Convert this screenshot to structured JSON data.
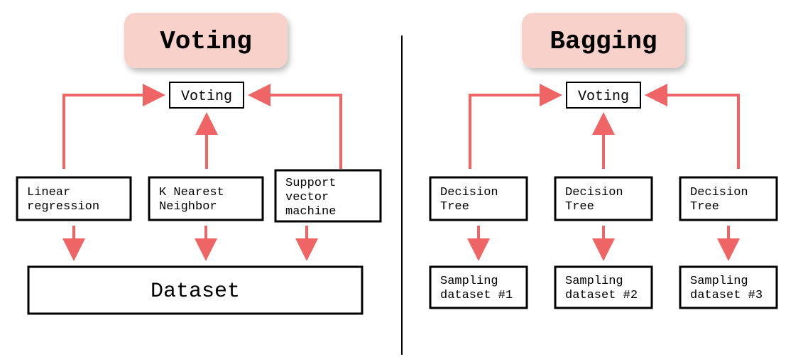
{
  "left": {
    "title": "Voting",
    "aggregator": "Voting",
    "models": [
      "Linear\nregression",
      "K Nearest\nNeighbor",
      "Support\nvector\nmachine"
    ],
    "dataset": "Dataset"
  },
  "right": {
    "title": "Bagging",
    "aggregator": "Voting",
    "models": [
      "Decision\nTree",
      "Decision\nTree",
      "Decision\nTree"
    ],
    "datasets": [
      "Sampling\ndataset #1",
      "Sampling\ndataset #2",
      "Sampling\ndataset #3"
    ]
  },
  "colors": {
    "accent": "#ef6464",
    "card": "#f8d1cb"
  }
}
